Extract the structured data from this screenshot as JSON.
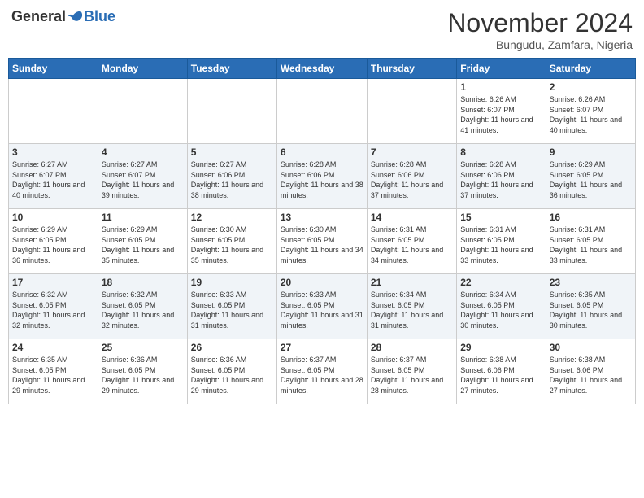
{
  "header": {
    "logo": {
      "general": "General",
      "blue": "Blue",
      "tagline": ""
    },
    "title": "November 2024",
    "location": "Bungudu, Zamfara, Nigeria"
  },
  "days_of_week": [
    "Sunday",
    "Monday",
    "Tuesday",
    "Wednesday",
    "Thursday",
    "Friday",
    "Saturday"
  ],
  "weeks": [
    [
      {
        "day": "",
        "info": ""
      },
      {
        "day": "",
        "info": ""
      },
      {
        "day": "",
        "info": ""
      },
      {
        "day": "",
        "info": ""
      },
      {
        "day": "",
        "info": ""
      },
      {
        "day": "1",
        "info": "Sunrise: 6:26 AM\nSunset: 6:07 PM\nDaylight: 11 hours and 41 minutes."
      },
      {
        "day": "2",
        "info": "Sunrise: 6:26 AM\nSunset: 6:07 PM\nDaylight: 11 hours and 40 minutes."
      }
    ],
    [
      {
        "day": "3",
        "info": "Sunrise: 6:27 AM\nSunset: 6:07 PM\nDaylight: 11 hours and 40 minutes."
      },
      {
        "day": "4",
        "info": "Sunrise: 6:27 AM\nSunset: 6:07 PM\nDaylight: 11 hours and 39 minutes."
      },
      {
        "day": "5",
        "info": "Sunrise: 6:27 AM\nSunset: 6:06 PM\nDaylight: 11 hours and 38 minutes."
      },
      {
        "day": "6",
        "info": "Sunrise: 6:28 AM\nSunset: 6:06 PM\nDaylight: 11 hours and 38 minutes."
      },
      {
        "day": "7",
        "info": "Sunrise: 6:28 AM\nSunset: 6:06 PM\nDaylight: 11 hours and 37 minutes."
      },
      {
        "day": "8",
        "info": "Sunrise: 6:28 AM\nSunset: 6:06 PM\nDaylight: 11 hours and 37 minutes."
      },
      {
        "day": "9",
        "info": "Sunrise: 6:29 AM\nSunset: 6:05 PM\nDaylight: 11 hours and 36 minutes."
      }
    ],
    [
      {
        "day": "10",
        "info": "Sunrise: 6:29 AM\nSunset: 6:05 PM\nDaylight: 11 hours and 36 minutes."
      },
      {
        "day": "11",
        "info": "Sunrise: 6:29 AM\nSunset: 6:05 PM\nDaylight: 11 hours and 35 minutes."
      },
      {
        "day": "12",
        "info": "Sunrise: 6:30 AM\nSunset: 6:05 PM\nDaylight: 11 hours and 35 minutes."
      },
      {
        "day": "13",
        "info": "Sunrise: 6:30 AM\nSunset: 6:05 PM\nDaylight: 11 hours and 34 minutes."
      },
      {
        "day": "14",
        "info": "Sunrise: 6:31 AM\nSunset: 6:05 PM\nDaylight: 11 hours and 34 minutes."
      },
      {
        "day": "15",
        "info": "Sunrise: 6:31 AM\nSunset: 6:05 PM\nDaylight: 11 hours and 33 minutes."
      },
      {
        "day": "16",
        "info": "Sunrise: 6:31 AM\nSunset: 6:05 PM\nDaylight: 11 hours and 33 minutes."
      }
    ],
    [
      {
        "day": "17",
        "info": "Sunrise: 6:32 AM\nSunset: 6:05 PM\nDaylight: 11 hours and 32 minutes."
      },
      {
        "day": "18",
        "info": "Sunrise: 6:32 AM\nSunset: 6:05 PM\nDaylight: 11 hours and 32 minutes."
      },
      {
        "day": "19",
        "info": "Sunrise: 6:33 AM\nSunset: 6:05 PM\nDaylight: 11 hours and 31 minutes."
      },
      {
        "day": "20",
        "info": "Sunrise: 6:33 AM\nSunset: 6:05 PM\nDaylight: 11 hours and 31 minutes."
      },
      {
        "day": "21",
        "info": "Sunrise: 6:34 AM\nSunset: 6:05 PM\nDaylight: 11 hours and 31 minutes."
      },
      {
        "day": "22",
        "info": "Sunrise: 6:34 AM\nSunset: 6:05 PM\nDaylight: 11 hours and 30 minutes."
      },
      {
        "day": "23",
        "info": "Sunrise: 6:35 AM\nSunset: 6:05 PM\nDaylight: 11 hours and 30 minutes."
      }
    ],
    [
      {
        "day": "24",
        "info": "Sunrise: 6:35 AM\nSunset: 6:05 PM\nDaylight: 11 hours and 29 minutes."
      },
      {
        "day": "25",
        "info": "Sunrise: 6:36 AM\nSunset: 6:05 PM\nDaylight: 11 hours and 29 minutes."
      },
      {
        "day": "26",
        "info": "Sunrise: 6:36 AM\nSunset: 6:05 PM\nDaylight: 11 hours and 29 minutes."
      },
      {
        "day": "27",
        "info": "Sunrise: 6:37 AM\nSunset: 6:05 PM\nDaylight: 11 hours and 28 minutes."
      },
      {
        "day": "28",
        "info": "Sunrise: 6:37 AM\nSunset: 6:05 PM\nDaylight: 11 hours and 28 minutes."
      },
      {
        "day": "29",
        "info": "Sunrise: 6:38 AM\nSunset: 6:06 PM\nDaylight: 11 hours and 27 minutes."
      },
      {
        "day": "30",
        "info": "Sunrise: 6:38 AM\nSunset: 6:06 PM\nDaylight: 11 hours and 27 minutes."
      }
    ]
  ]
}
